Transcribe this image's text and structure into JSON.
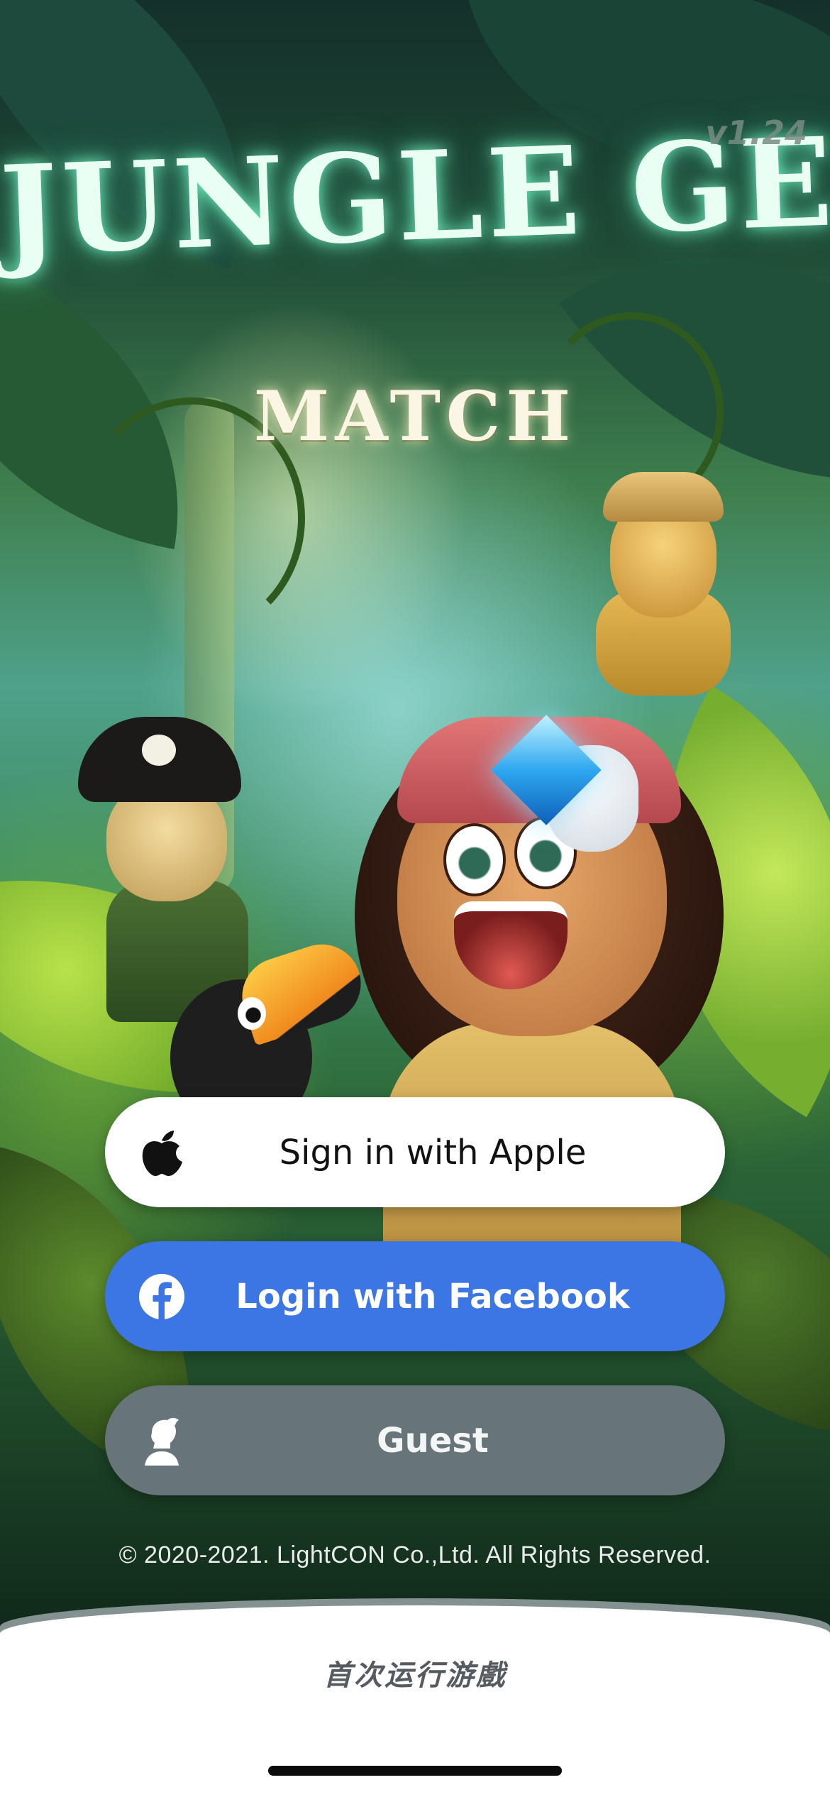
{
  "app": {
    "version": "v1.24",
    "title": "JUNGLE GEM",
    "subtitle": "MATCH"
  },
  "login": {
    "apple_label": "Sign in with Apple",
    "facebook_label": "Login with Facebook",
    "guest_label": "Guest",
    "apple_icon": "apple-logo-icon",
    "facebook_icon": "facebook-logo-icon",
    "guest_icon": "guest-silhouette-icon"
  },
  "footer": {
    "copyright": "© 2020-2021. LightCON Co.,Ltd. All Rights Reserved."
  },
  "bottom": {
    "first_run_text": "首次运行游戲"
  },
  "colors": {
    "facebook_blue": "#3b76e4",
    "guest_gray": "#677479",
    "apple_white": "#ffffff"
  }
}
